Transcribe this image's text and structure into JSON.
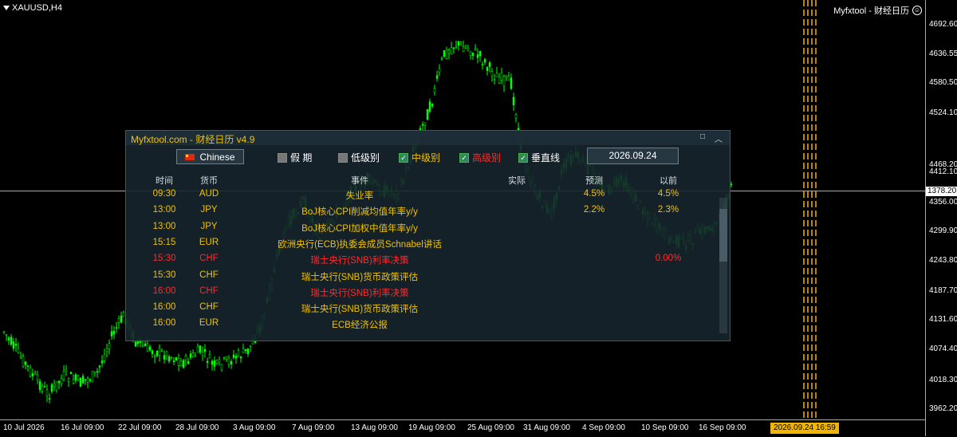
{
  "chart_window": {
    "symbol": "XAUUSD,H4",
    "indicator_label": "Myfxtool - 财经日历",
    "current_price": "1378.20",
    "current_time": "2026.09.24 16:59",
    "price_ticks": [
      "4692.60",
      "4636.55",
      "4580.50",
      "4524.10",
      "4468.20",
      "4412.10",
      "4356.00",
      "4299.90",
      "4243.80",
      "4187.70",
      "4131.60",
      "4074.40",
      "4018.30",
      "3962.20"
    ],
    "time_ticks": [
      "10 Jul 2026",
      "16 Jul 09:00",
      "22 Jul 09:00",
      "28 Jul 09:00",
      "3 Aug 09:00",
      "7 Aug 09:00",
      "13 Aug 09:00",
      "19 Aug 09:00",
      "25 Aug 09:00",
      "31 Aug 09:00",
      "4 Sep 09:00",
      "10 Sep 09:00",
      "16 Sep 09:00"
    ],
    "colors": {
      "bull": "#00ff00",
      "bear": "#00ff00",
      "background": "#000000",
      "vline": "#f2b600"
    }
  },
  "calendar": {
    "title": "Myfxtool.com - 财经日历  v4.9",
    "language_button": "Chinese",
    "filters": [
      {
        "label": "假  期",
        "checked": false,
        "color": "#ffffff"
      },
      {
        "label": "低级别",
        "checked": false,
        "color": "#ffffff"
      },
      {
        "label": "中级别",
        "checked": true,
        "color": "#f2c200"
      },
      {
        "label": "高级别",
        "checked": true,
        "color": "#ff2b2b"
      },
      {
        "label": "垂直线",
        "checked": true,
        "color": "#ffffff"
      }
    ],
    "date": "2026.09.24",
    "columns": [
      "时间",
      "货币",
      "事件",
      "实际",
      "预测",
      "以前"
    ],
    "rows": [
      {
        "time": "09:30",
        "currency": "AUD",
        "event": "失业率",
        "actual": "",
        "forecast": "4.5%",
        "previous": "4.5%",
        "level": "mid"
      },
      {
        "time": "13:00",
        "currency": "JPY",
        "event": "BoJ核心CPI削减均值年率y/y",
        "actual": "",
        "forecast": "2.2%",
        "previous": "2.3%",
        "level": "mid"
      },
      {
        "time": "13:00",
        "currency": "JPY",
        "event": "BoJ核心CPI加权中值年率y/y",
        "actual": "",
        "forecast": "",
        "previous": "",
        "level": "mid"
      },
      {
        "time": "15:15",
        "currency": "EUR",
        "event": "欧洲央行(ECB)执委会成员Schnabel讲话",
        "actual": "",
        "forecast": "",
        "previous": "",
        "level": "mid"
      },
      {
        "time": "15:30",
        "currency": "CHF",
        "event": "瑞士央行(SNB)利率决策",
        "actual": "",
        "forecast": "",
        "previous": "0.00%",
        "level": "high"
      },
      {
        "time": "15:30",
        "currency": "CHF",
        "event": "瑞士央行(SNB)货币政策评估",
        "actual": "",
        "forecast": "",
        "previous": "",
        "level": "mid"
      },
      {
        "time": "16:00",
        "currency": "CHF",
        "event": "瑞士央行(SNB)利率决策",
        "actual": "",
        "forecast": "",
        "previous": "",
        "level": "high"
      },
      {
        "time": "16:00",
        "currency": "CHF",
        "event": "瑞士央行(SNB)货币政策评估",
        "actual": "",
        "forecast": "",
        "previous": "",
        "level": "mid"
      },
      {
        "time": "16:00",
        "currency": "EUR",
        "event": "ECB经济公报",
        "actual": "",
        "forecast": "",
        "previous": "",
        "level": "mid"
      }
    ],
    "level_colors": {
      "mid": "#f2c200",
      "high": "#ff2b2b"
    }
  }
}
